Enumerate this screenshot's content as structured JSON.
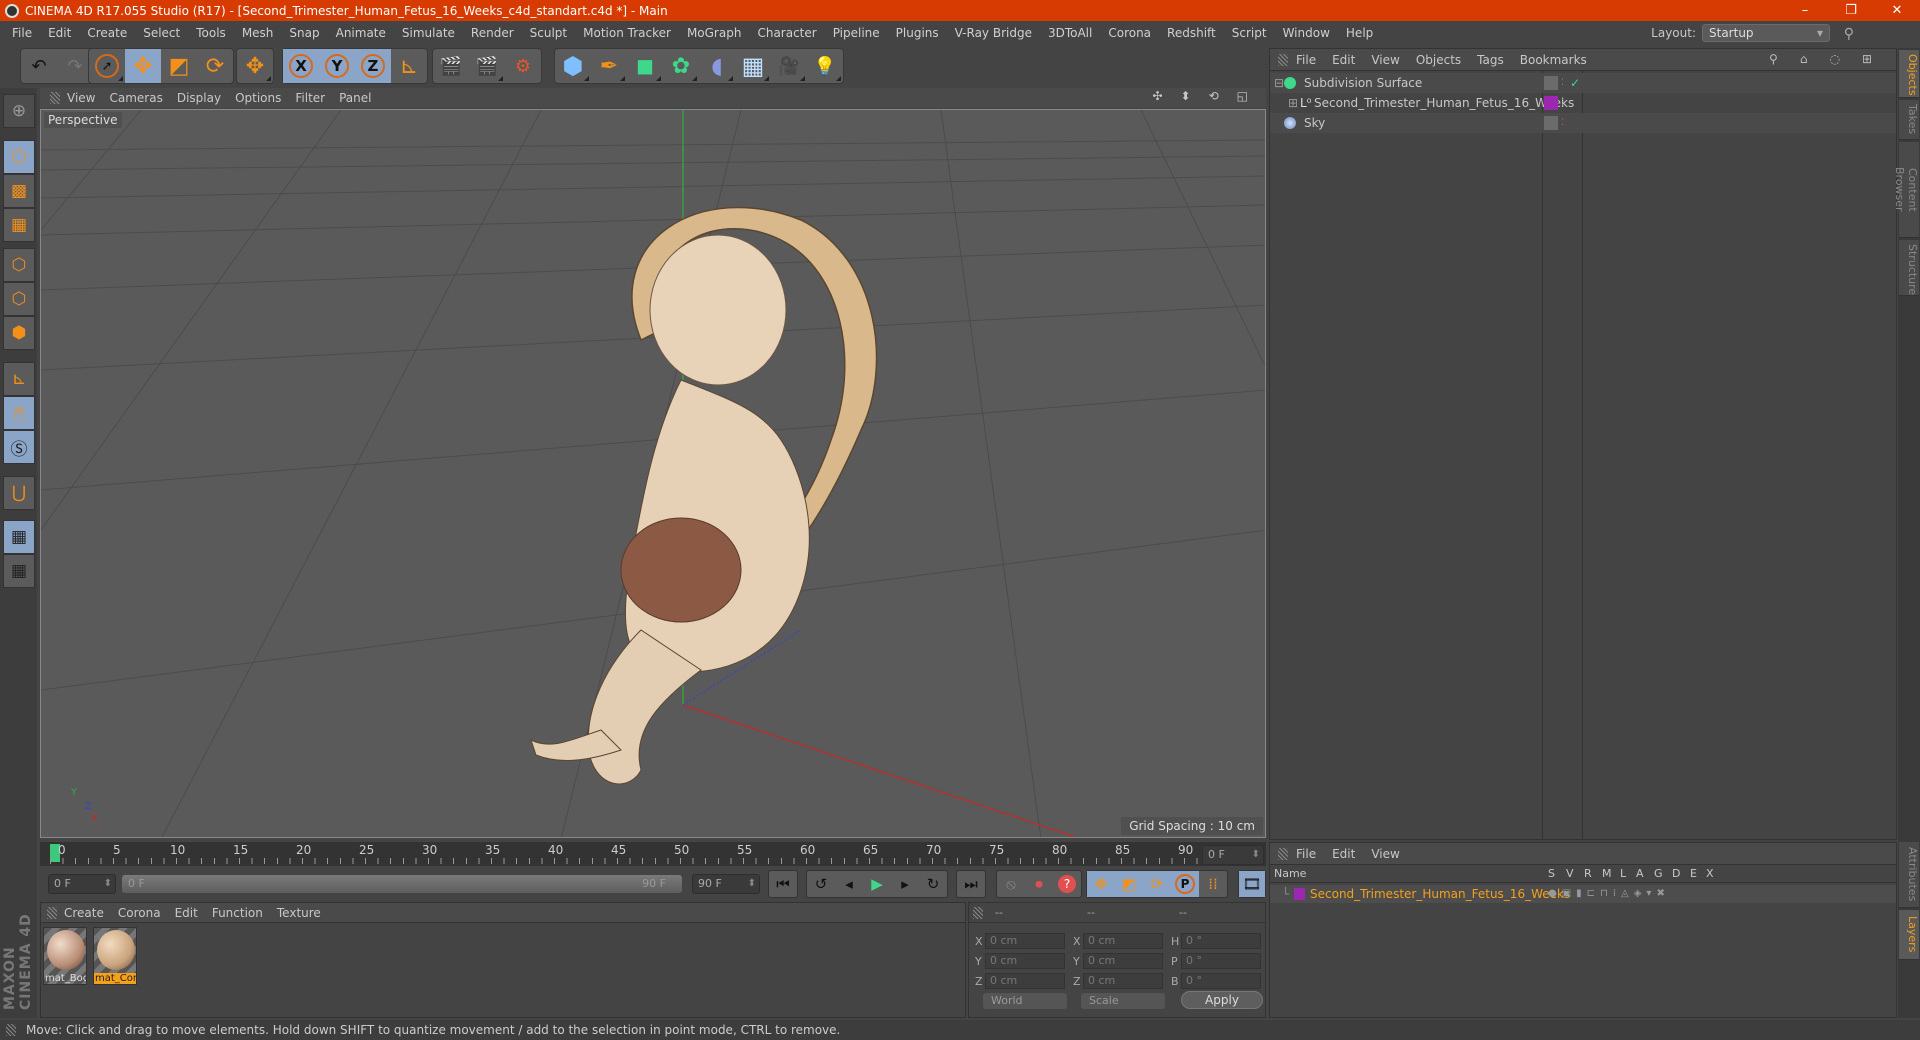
{
  "window": {
    "title": "CINEMA 4D R17.055 Studio (R17) - [Second_Trimester_Human_Fetus_16_Weeks_c4d_standart.c4d *] - Main",
    "minimize": "–",
    "restore": "❐",
    "close": "✕"
  },
  "menubar": [
    "File",
    "Edit",
    "Create",
    "Select",
    "Tools",
    "Mesh",
    "Snap",
    "Animate",
    "Simulate",
    "Render",
    "Sculpt",
    "Motion Tracker",
    "MoGraph",
    "Character",
    "Pipeline",
    "Plugins",
    "V-Ray Bridge",
    "3DToAll",
    "Corona",
    "Redshift",
    "Script",
    "Window",
    "Help"
  ],
  "layout": {
    "label": "Layout:",
    "value": "Startup"
  },
  "toolbar": {
    "undo": "↶",
    "redo": "↷",
    "select": "➚",
    "move": "✥",
    "scale": "◩",
    "rotate": "⟳",
    "transform": "✥",
    "x": "X",
    "y": "Y",
    "z": "Z",
    "coord": "⊾",
    "render_view": "🎬",
    "render": "🎬",
    "render_settings": "⚙",
    "cube": "⬢",
    "pen": "✒",
    "subdiv": "◼",
    "array": "✿",
    "deformer": "◖",
    "floor": "▦",
    "camera": "🎥",
    "light": "💡"
  },
  "viewport": {
    "menu": [
      "View",
      "Cameras",
      "Display",
      "Options",
      "Filter",
      "Panel"
    ],
    "label": "Perspective",
    "grid_spacing": "Grid Spacing : 10 cm",
    "nav_icons": [
      "✣",
      "⬍",
      "⟲",
      "◱"
    ],
    "axis": {
      "x": "X",
      "y": "Y",
      "z": "Z"
    }
  },
  "timeline": {
    "ticks": [
      "0",
      "5",
      "10",
      "15",
      "20",
      "25",
      "30",
      "35",
      "40",
      "45",
      "50",
      "55",
      "60",
      "65",
      "70",
      "75",
      "80",
      "85",
      "90"
    ],
    "current_frame": "0 F",
    "start": "0 F",
    "range_start": "0 F",
    "range_end": "90 F",
    "end": "90 F"
  },
  "playback": {
    "first": "⏮",
    "prev_key": "↺",
    "prev": "◂",
    "play": "▶",
    "next": "▸",
    "next_key": "↻",
    "last": "⏭"
  },
  "keyframes": {
    "record_off": "⦸",
    "record": "⏺",
    "autokey": "?",
    "move": "✥",
    "scale": "◩",
    "rotate": "⟳",
    "param": "P",
    "dots": "⁞⁞",
    "film": "🎞"
  },
  "material_panel": {
    "menu": [
      "Create",
      "Corona",
      "Edit",
      "Function",
      "Texture"
    ],
    "materials": [
      {
        "name": "mat_Boc",
        "selected": false,
        "color": "#b98d76"
      },
      {
        "name": "mat_Cor",
        "selected": true,
        "color": "#c9a37c"
      }
    ]
  },
  "coords": {
    "headers": [
      "--",
      "--",
      "--"
    ],
    "rows": [
      {
        "l1": "X",
        "v1": "0 cm",
        "l2": "X",
        "v2": "0 cm",
        "l3": "H",
        "v3": "0 °"
      },
      {
        "l1": "Y",
        "v1": "0 cm",
        "l2": "Y",
        "v2": "0 cm",
        "l3": "P",
        "v3": "0 °"
      },
      {
        "l1": "Z",
        "v1": "0 cm",
        "l2": "Z",
        "v2": "0 cm",
        "l3": "B",
        "v3": "0 °"
      }
    ],
    "world": "World",
    "scale": "Scale",
    "apply": "Apply"
  },
  "object_manager": {
    "menu": [
      "File",
      "Edit",
      "View",
      "Objects",
      "Tags",
      "Bookmarks"
    ],
    "objects": [
      {
        "name": "Subdivision Surface",
        "tag_color": "#6b6b6b",
        "check": "✓"
      },
      {
        "name": "Second_Trimester_Human_Fetus_16_Weeks",
        "tag_color": "#9c27b0"
      },
      {
        "name": "Sky",
        "tag_color": "#6b6b6b"
      }
    ]
  },
  "side_tabs": [
    "Objects",
    "Takes",
    "Content Browser",
    "Structure",
    "Attributes",
    "Layers"
  ],
  "layer_manager": {
    "menu": [
      "File",
      "Edit",
      "View"
    ],
    "columns": [
      "Name",
      "S",
      "V",
      "R",
      "M",
      "L",
      "A",
      "G",
      "D",
      "E",
      "X"
    ],
    "layers": [
      {
        "name": "Second_Trimester_Human_Fetus_16_Weeks",
        "color": "#9c27b0"
      }
    ]
  },
  "brand": "MAXON CINEMA 4D",
  "status": "Move: Click and drag to move elements. Hold down SHIFT to quantize movement / add to the selection in point mode, CTRL to remove.",
  "colors": {
    "accent": "#d83b01",
    "selected": "#f5a01a",
    "active_button": "#8aa5c8"
  }
}
